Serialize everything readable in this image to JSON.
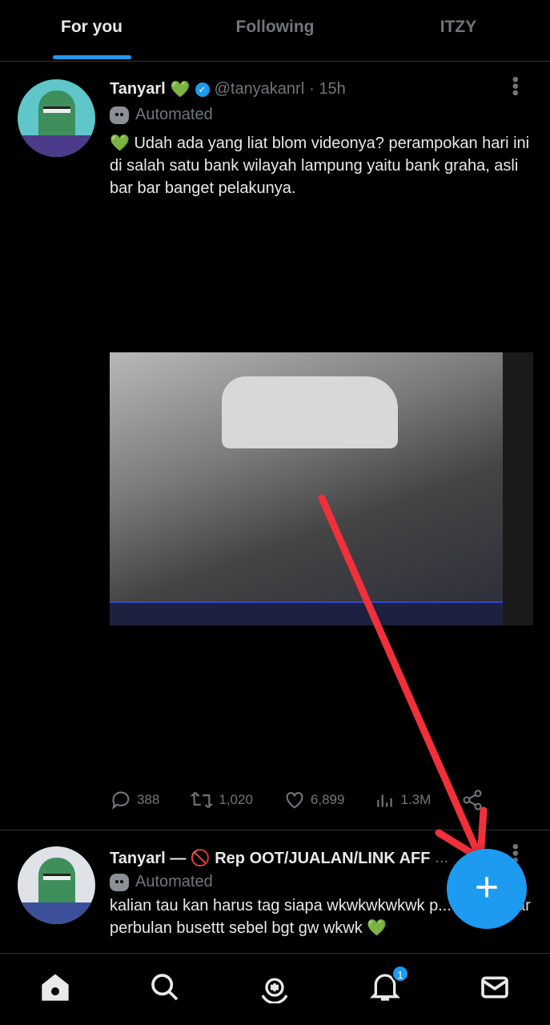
{
  "tabs": [
    {
      "label": "For you",
      "active": true
    },
    {
      "label": "Following"
    },
    {
      "label": "ITZY"
    }
  ],
  "tweets": [
    {
      "name": "Tanyarl",
      "emoji": "💚",
      "verified": true,
      "handle": "@tanyakanrl",
      "time": "· 15h",
      "label": "Automated",
      "text": "💚 Udah ada yang liat blom videonya?  perampokan hari ini di salah satu bank wilayah lampung yaitu bank graha, asli bar bar banget pelakunya.",
      "media": "video",
      "stats": {
        "replies": "388",
        "retweets": "1,020",
        "likes": "6,899",
        "views": "1.3M"
      }
    },
    {
      "name": "Tanyarl — 🚫 Rep OOT/JUALAN/LINK AFF",
      "ellipsis": "...",
      "label": "Automated",
      "text": "kalian tau kan harus tag siapa wkwkwkwkwk p... juga bayar perbulan busettt sebel bgt gw wkwk 💚"
    }
  ],
  "fab": {
    "icon": "plus-icon",
    "color": "#1d9bf0"
  },
  "annotation": {
    "type": "arrow",
    "color": "#f0303a"
  },
  "nav": {
    "items": [
      "home-icon",
      "search-icon",
      "spaces-icon",
      "notifications-icon",
      "messages-icon"
    ],
    "notification_count": "1"
  }
}
